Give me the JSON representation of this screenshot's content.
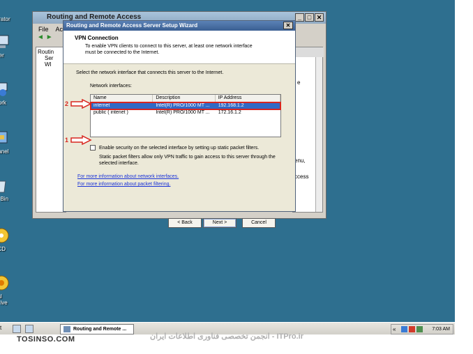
{
  "desktop": {
    "icons": [
      {
        "label": "strator",
        "icon": "user-folder-icon"
      },
      {
        "label": "uter",
        "icon": "computer-icon"
      },
      {
        "label": "work",
        "icon": "network-icon"
      },
      {
        "label": "Panel",
        "icon": "control-panel-icon"
      },
      {
        "label": "le Bin",
        "icon": "recycle-bin-icon"
      },
      {
        "label": "eCD",
        "icon": "cd-icon"
      },
      {
        "label": "ual",
        "label2": "Drive",
        "icon": "drive-icon"
      }
    ]
  },
  "mmc": {
    "title": "Routing and Remote Access",
    "menu": [
      "File",
      "Act"
    ],
    "tree": [
      "Routin",
      "Ser",
      "WI"
    ],
    "right_fragments": [
      "e",
      "enu,",
      "ccess"
    ]
  },
  "wizard": {
    "title": "Routing and Remote Access Server Setup Wizard",
    "header": "VPN Connection",
    "subheader": "To enable VPN clients to connect to this server, at least one network interface must be connected to the Internet.",
    "instruction": "Select the network interface that connects this server to the Internet.",
    "list_label": "Network interfaces:",
    "columns": [
      "Name",
      "Description",
      "IP Address"
    ],
    "rows": [
      {
        "name": "internet",
        "description": "Intel(R) PRO/1000 MT ...",
        "ip": "192.168.1.2",
        "selected": true
      },
      {
        "name": "public ( intenet )",
        "description": "Intel(R) PRO/1000 MT ...",
        "ip": "172.16.1.2",
        "selected": false
      }
    ],
    "checkbox_label": "Enable security on the selected interface by setting up static packet filters.",
    "checkbox_checked": false,
    "checkbox_desc": "Static packet filters allow only VPN traffic to gain access to this server through the selected interface.",
    "link1": "For more information about network interfaces.",
    "link2": "For more information about packet filtering.",
    "buttons": {
      "back": "< Back",
      "next": "Next >",
      "cancel": "Cancel"
    }
  },
  "annotations": {
    "mark1": "1",
    "mark2": "2",
    "color": "#d8261f"
  },
  "taskbar": {
    "task_label": "Routing and Remote ...",
    "clock": "7:03 AM",
    "tray_chevron": "«"
  },
  "watermarks": {
    "left": "TOSINSO.COM",
    "right": "انجمن تخصصی فناوری اطلاعات ایران - ITPro.ir"
  }
}
